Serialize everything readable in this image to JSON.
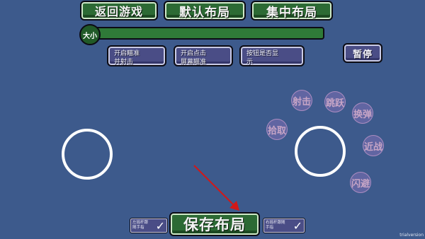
{
  "top_buttons": {
    "back": "返回游戏",
    "default_layout": "默认布局",
    "centered_layout": "集中布局"
  },
  "size_slider": {
    "label": "大小",
    "value": 1.0
  },
  "options": {
    "aim_fire": "开启瞄准\n并射击",
    "tap_aim": "开启点击\n屏幕瞄准",
    "show_buttons": "按钮是否显\n示"
  },
  "pause": "暂停",
  "action_buttons": {
    "shoot": "射击",
    "jump": "跳跃",
    "swap": "换弹",
    "pickup": "拾取",
    "melee": "近战",
    "dodge": "闪避"
  },
  "bottom": {
    "left_follow": "左摇杆跟\n随手指",
    "save": "保存布局",
    "right_follow": "右摇杆跟随\n手指",
    "check_mark": "✓",
    "watermark": "trialversion"
  },
  "colors": {
    "background": "#3d5a8c",
    "green_button": "#2c6a34",
    "purple_button": "#4a4d86",
    "arrow": "#d21818"
  }
}
